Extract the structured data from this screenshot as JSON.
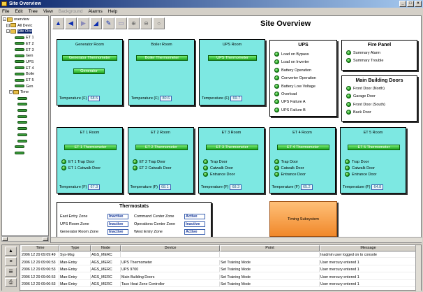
{
  "window": {
    "title": "Site Overview",
    "buttons": [
      "_",
      "□",
      "×"
    ]
  },
  "menu": {
    "items": [
      "File",
      "Edit",
      "Tree",
      "View",
      "Background",
      "Alarms",
      "Help"
    ],
    "disabled": "Background"
  },
  "tree": {
    "nodes": [
      {
        "label": "overview",
        "kind": "folder",
        "selected": false
      },
      {
        "label": "All Devic",
        "kind": "folder",
        "selected": false
      },
      {
        "label": "Site Ove",
        "kind": "folder",
        "selected": true
      },
      {
        "label": "ET 1",
        "kind": "thermo"
      },
      {
        "label": "ET 2",
        "kind": "thermo"
      },
      {
        "label": "ET 3",
        "kind": "thermo"
      },
      {
        "label": "Gen",
        "kind": "thermo"
      },
      {
        "label": "UPS",
        "kind": "thermo"
      },
      {
        "label": "ET 4",
        "kind": "thermo"
      },
      {
        "label": "Boile",
        "kind": "thermo"
      },
      {
        "label": "ET 5",
        "kind": "thermo"
      },
      {
        "label": "Gen",
        "kind": "thermo"
      },
      {
        "label": "Time",
        "kind": "folder"
      },
      {
        "label": "",
        "kind": "thermo"
      },
      {
        "label": "",
        "kind": "thermo"
      },
      {
        "label": "",
        "kind": "thermo"
      },
      {
        "label": "",
        "kind": "thermo"
      },
      {
        "label": "",
        "kind": "thermo"
      },
      {
        "label": "",
        "kind": "thermo"
      },
      {
        "label": "",
        "kind": "thermo"
      },
      {
        "label": "",
        "kind": "thermo"
      },
      {
        "label": "",
        "kind": "thermo"
      },
      {
        "label": "",
        "kind": "thermo"
      }
    ]
  },
  "page": {
    "title": "Site Overview"
  },
  "rooms": {
    "generator": {
      "title": "Generator Room",
      "buttons": [
        "Generator Thermometer",
        "Generator"
      ],
      "temp_label": "Temperature (F)",
      "temp": "68.5"
    },
    "boiler": {
      "title": "Boiler Room",
      "buttons": [
        "Boiler Thermometer"
      ],
      "temp_label": "Temperature (F)",
      "temp": "80.6"
    },
    "ups": {
      "title": "UPS Room",
      "buttons": [
        "UPS Thermometer"
      ],
      "temp_label": "Temperature (F)",
      "temp": "69.7"
    },
    "et1": {
      "title": "ET 1 Room",
      "button": "ET 1 Thermometer",
      "doors": [
        "ET 1 Trap Door",
        "ET 1 Catwalk Door"
      ],
      "temp_label": "Temperature (F)",
      "temp": "67.3"
    },
    "et2": {
      "title": "ET 2 Room",
      "button": "ET 2 Thermometer",
      "doors": [
        "ET 2 Trap Door",
        "ET 2 Catwalk Door"
      ],
      "temp_label": "Temperature (F)",
      "temp": "68.1"
    },
    "et3": {
      "title": "ET 3 Room",
      "button": "ET 3 Thermometer",
      "doors": [
        "Trap Door",
        "Catwalk Door",
        "Entrance Door"
      ],
      "temp_label": "Temperature (F)",
      "temp": "68.3"
    },
    "et4": {
      "title": "ET 4 Room",
      "button": "ET 4 Thermometer",
      "doors": [
        "Trap Door",
        "Catwalk Door",
        "Entrance Door"
      ],
      "temp_label": "Temperature (F)",
      "temp": "65.2"
    },
    "et5": {
      "title": "ET 5 Room",
      "button": "ET 5 Thermometer",
      "doors": [
        "Trap Door",
        "Catwalk Door",
        "Entrance Door"
      ],
      "temp_label": "Temperature (F)",
      "temp": "64.8"
    }
  },
  "ups_panel": {
    "title": "UPS",
    "items": [
      "Load on Bypass",
      "Load on Inverter",
      "Battery Operation",
      "Converter Operation",
      "Battery Low Voltage",
      "Overload",
      "UPS Failure A",
      "UPS Failure B"
    ]
  },
  "fire_panel": {
    "title": "Fire Panel",
    "items": [
      "Summary Alarm",
      "Summary Trouble"
    ]
  },
  "doors_panel": {
    "title": "Main Building Doors",
    "items": [
      "Front Door (North)",
      "Garage Door",
      "Front Door (South)",
      "Back Door"
    ]
  },
  "thermostats": {
    "title": "Thermostats",
    "left": [
      {
        "label": "East Entry Zone",
        "status": "Inactive"
      },
      {
        "label": "UPS Room Zone",
        "status": "Inactive"
      },
      {
        "label": "Generator Room Zone",
        "status": "Inactive"
      }
    ],
    "right": [
      {
        "label": "Command Center Zone",
        "status": "Active"
      },
      {
        "label": "Operations Center Zone",
        "status": "Inactive"
      },
      {
        "label": "West Entry Zone",
        "status": "Active"
      }
    ]
  },
  "training": {
    "label": "Timing Subsystem"
  },
  "log": {
    "columns": [
      "Time",
      "Type",
      "Node",
      "Device",
      "Point",
      "Message"
    ],
    "rows": [
      [
        "2006 12 29 09:09:49",
        "Sys-Msg",
        "AGS_MERC",
        "",
        "",
        "Inadmin user logged on to console"
      ],
      [
        "2006 12 29 09:06:53",
        "Man-Entry",
        "AGS_MERC",
        "UPS Thermometer",
        "Set Training Mode",
        "User mercury entered 1"
      ],
      [
        "2006 12 29 09:06:53",
        "Man-Entry",
        "AGS_MERC",
        "UPS 9700",
        "Set Training Mode",
        "User mercury entered 1"
      ],
      [
        "2006 12 29 09:06:53",
        "Man-Entry",
        "AGS_MERC",
        "Main Building Doors",
        "Set Training Mode",
        "User mercury entered 1"
      ],
      [
        "2006 12 29 09:06:53",
        "Man-Entry",
        "AGS_MERC",
        "Taco Heat Zone Controller",
        "Set Training Mode",
        "User mercury entered 1"
      ]
    ]
  }
}
